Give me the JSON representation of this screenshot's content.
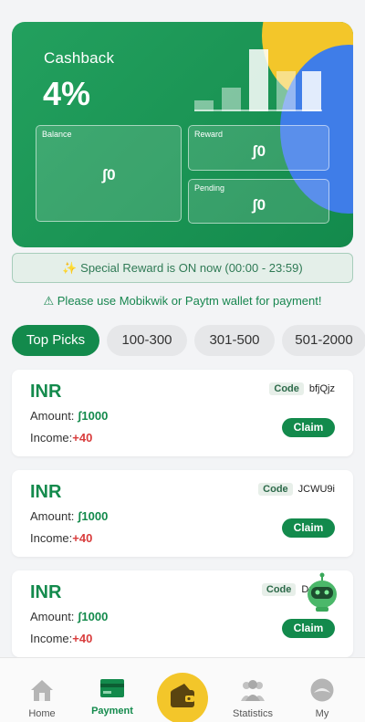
{
  "hero": {
    "title": "Cashback",
    "percent": "4%",
    "balance_label": "Balance",
    "balance_value": "ʃ0",
    "reward_label": "Reward",
    "reward_value": "ʃ0",
    "pending_label": "Pending",
    "pending_value": "ʃ0"
  },
  "special_reward": "✨ Special Reward is ON now (00:00 - 23:59)",
  "warning": "⚠ Please use Mobikwik or Paytm wallet for payment!",
  "tabs": [
    {
      "label": "Top Picks",
      "active": true
    },
    {
      "label": "100-300",
      "active": false
    },
    {
      "label": "301-500",
      "active": false
    },
    {
      "label": "501-2000",
      "active": false
    }
  ],
  "offers": [
    {
      "currency": "INR",
      "amount_label": "Amount:",
      "amount": "ʃ1000",
      "income_label": "Income:",
      "income": "+40",
      "code_label": "Code",
      "code": "bfjQjz",
      "claim": "Claim"
    },
    {
      "currency": "INR",
      "amount_label": "Amount:",
      "amount": "ʃ1000",
      "income_label": "Income:",
      "income": "+40",
      "code_label": "Code",
      "code": "JCWU9i",
      "claim": "Claim"
    },
    {
      "currency": "INR",
      "amount_label": "Amount:",
      "amount": "ʃ1000",
      "income_label": "Income:",
      "income": "+40",
      "code_label": "Code",
      "code": "DpO",
      "claim": "Claim"
    }
  ],
  "bottom_nav": [
    {
      "label": "Home",
      "icon": "home-icon"
    },
    {
      "label": "Payment",
      "icon": "card-icon",
      "active": true
    },
    {
      "label": "",
      "icon": "wallet-icon"
    },
    {
      "label": "Statistics",
      "icon": "people-icon"
    },
    {
      "label": "My",
      "icon": "user-icon"
    }
  ],
  "colors": {
    "brand": "#138a4c",
    "accent": "#f3c62a",
    "income": "#d93d3d",
    "blue": "#3f7de8"
  }
}
